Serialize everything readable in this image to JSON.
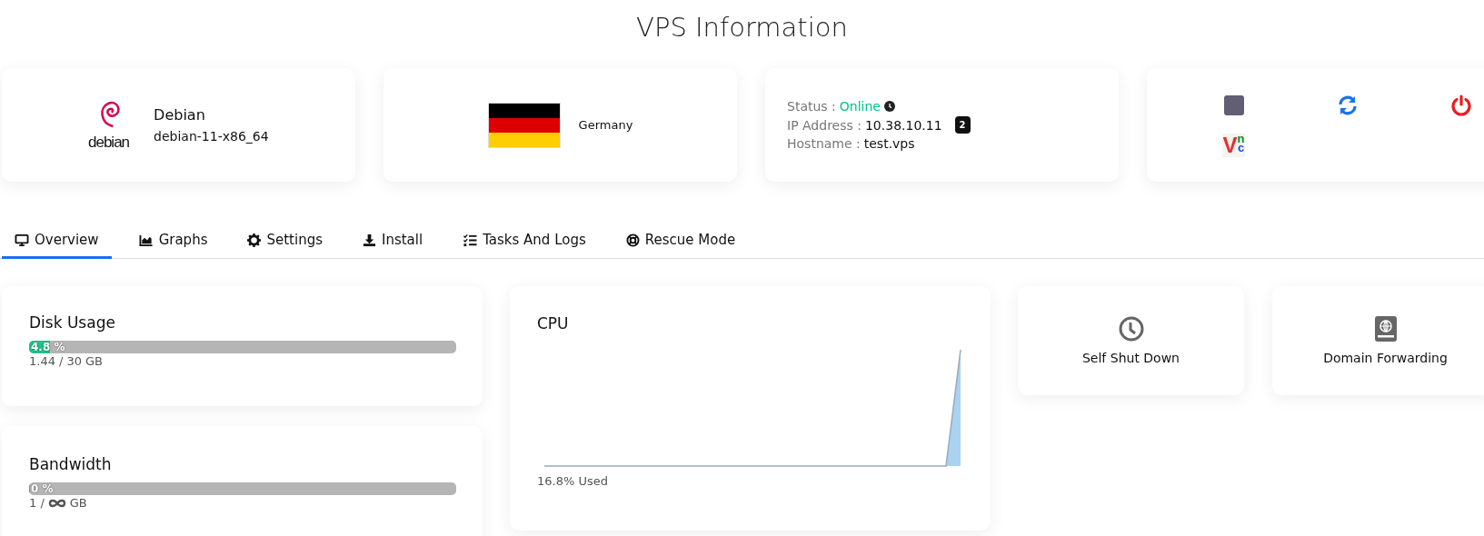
{
  "page_title": "VPS Information",
  "os": {
    "logo_text": "debian",
    "name": "Debian",
    "template": "debian-11-x86_64"
  },
  "location": {
    "country": "Germany"
  },
  "info": {
    "status_label": "Status :",
    "status": "Online",
    "ip_label": "IP Address :",
    "ip": "10.38.10.11",
    "ip_count": "2",
    "hostname_label": "Hostname :",
    "hostname": "test.vps"
  },
  "power_actions": [
    {
      "kind": "stop"
    },
    {
      "kind": "restart"
    },
    {
      "kind": "power"
    },
    {
      "kind": "vnc",
      "letters": [
        "V",
        "n",
        "c"
      ]
    }
  ],
  "tabs": [
    {
      "label": "Overview",
      "selected": true
    },
    {
      "label": "Graphs",
      "selected": false
    },
    {
      "label": "Settings",
      "selected": false
    },
    {
      "label": "Install",
      "selected": false
    },
    {
      "label": "Tasks And Logs",
      "selected": false
    },
    {
      "label": "Rescue Mode",
      "selected": false
    }
  ],
  "usage": [
    {
      "title": "Disk Usage",
      "level": 0.048,
      "percent": "4.8 %",
      "used": "1.44 /",
      "total": "30",
      "unit": "GB",
      "infinite": false
    },
    {
      "title": "Bandwidth",
      "level": 0,
      "percent": "0 %",
      "used": "1 /",
      "unit": "GB",
      "infinite": true
    }
  ],
  "cpu": {
    "title": "CPU",
    "reading": "16.8% Used"
  },
  "tools": [
    {
      "label": "Self Shut Down"
    },
    {
      "label": "Domain Forwarding"
    }
  ]
}
